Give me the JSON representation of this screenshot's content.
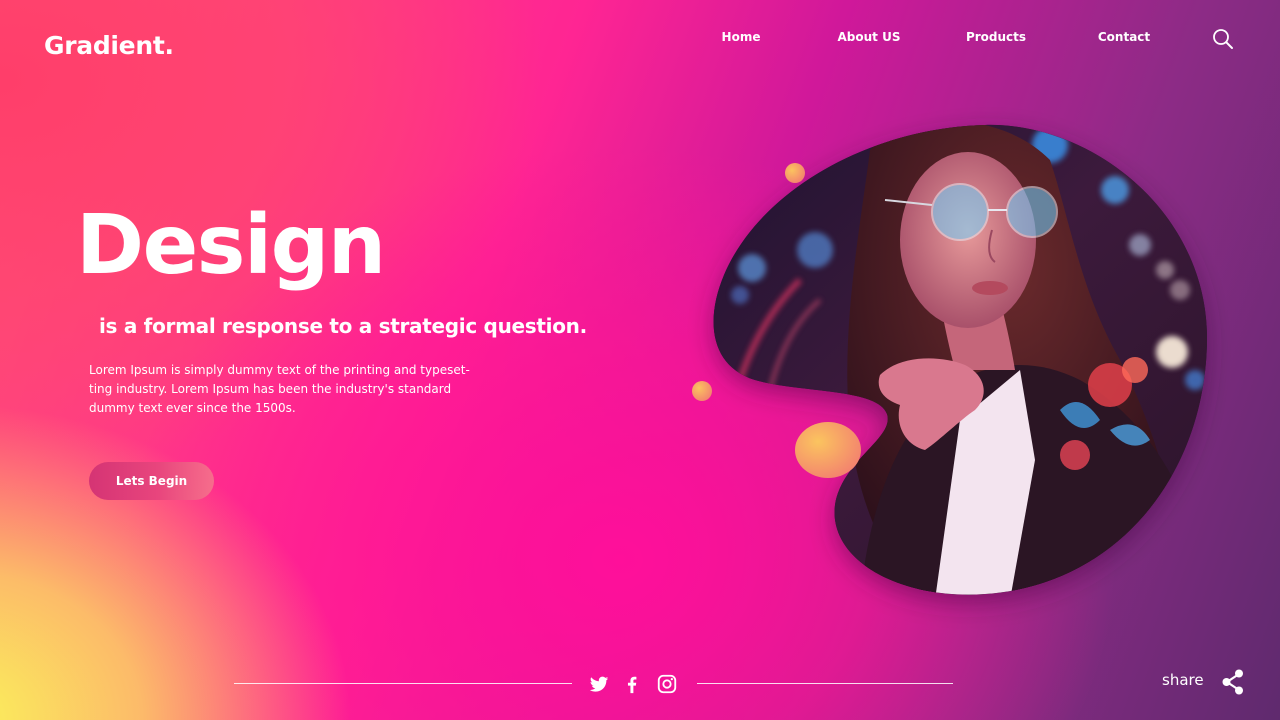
{
  "brand": {
    "logo_text": "Gradient."
  },
  "nav": {
    "items": [
      {
        "label": "Home"
      },
      {
        "label": "About US"
      },
      {
        "label": "Products"
      },
      {
        "label": "Contact"
      }
    ],
    "search_icon": "search-icon"
  },
  "hero": {
    "title": "Design",
    "subtitle": "is a formal response to a strategic question.",
    "body": "Lorem Ipsum is simply dummy text of the printing and typeset-ting industry. Lorem Ipsum has been the industry's standard dummy text ever since the 1500s.",
    "cta_label": "Lets Begin"
  },
  "footer": {
    "social_icons": [
      "twitter-icon",
      "facebook-icon",
      "instagram-icon"
    ],
    "share_label": "share",
    "share_icon": "share-icon"
  },
  "colors": {
    "accent_orange": "#f7a55a",
    "button": "#d8367a",
    "pink": "#ff1493",
    "purple": "#8a2d86"
  }
}
